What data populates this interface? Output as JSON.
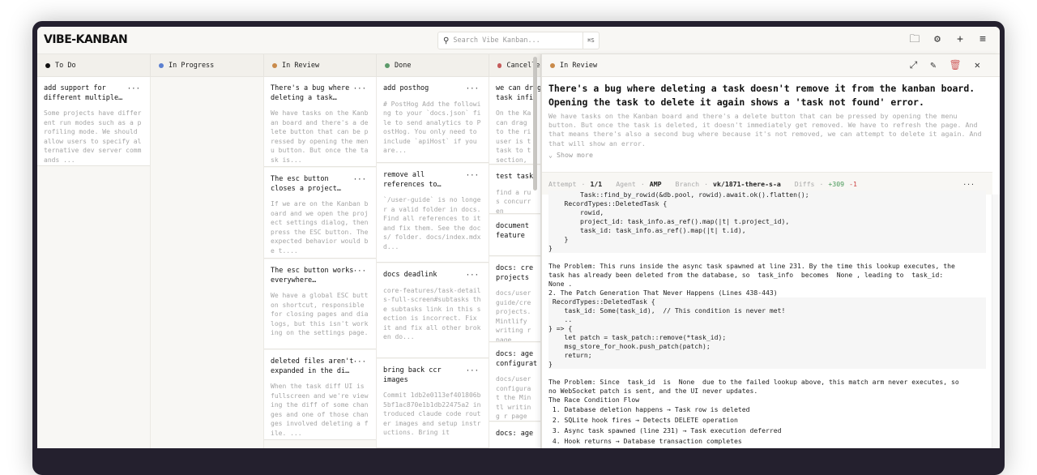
{
  "app": {
    "logo": "VIBE-KANBAN",
    "search_placeholder": "Search Vibe Kanban...",
    "search_shortcut": "⌘S"
  },
  "toolbar": {
    "icons": [
      "folder-icon",
      "gear-icon",
      "plus-icon",
      "menu-icon"
    ]
  },
  "columns": [
    {
      "label": "To Do",
      "color": "#111111",
      "cards": [
        {
          "title": "add support for different multiple…",
          "desc": "Some projects have different run modes such as a profiling mode. We should allow users to specify alternative dev server commands ..."
        }
      ]
    },
    {
      "label": "In Progress",
      "color": "#5b7fd0",
      "cards": []
    },
    {
      "label": "In Review",
      "color": "#c98a4a",
      "cards": [
        {
          "title": "There's a bug where deleting a task…",
          "desc": "We have tasks on the Kanban board and there's a delete button that can be pressed by opening the menu button. But once the task is..."
        },
        {
          "title": "The esc button closes a project…",
          "desc": "If we are on the Kanban board and we open the project settings dialog, then press the ESC button. The expected behavior would be t...."
        },
        {
          "title": "The esc button works everywhere…",
          "desc": "We have a global ESC button shortcut, responsible for closing pages and dialogs, but this isn't working on the settings page."
        },
        {
          "title": "deleted files aren't expanded in the di…",
          "desc": "When the task diff UI is fullscreen and we're viewing the diff of some changes and one of those changes involved deleting a file. ..."
        }
      ]
    },
    {
      "label": "Done",
      "color": "#5c9a6a",
      "cards": [
        {
          "title": "add posthog",
          "desc": "# PostHog Add the following to your `docs.json` file to send analytics to PostHog. You only need to include `apiHost` if you are..."
        },
        {
          "title": "remove all references to…",
          "desc": "`/user-guide` is no longer a valid folder in docs. Find all references to it and fix them. See the docs/ folder. docs/index.mdx d..."
        },
        {
          "title": "docs deadlink",
          "desc": "core-features/task-details-full-screen#subtasks the subtasks link in this section is incorrect. Fix it and fix all other broken do..."
        },
        {
          "title": "bring back ccr images",
          "desc": "Commit 1db2e0113ef401806b5bf1ac870e1b1db22475a2 introduced claude code router images and setup instructions. Bring it"
        }
      ]
    },
    {
      "label": "Cancelled",
      "color": "#c45a5a",
      "cards": [
        {
          "title": "we can drag task infin",
          "desc": "On the Ka can drag to the ri user is t task to t section,"
        },
        {
          "title": "test task",
          "desc": "find a rus concurren"
        },
        {
          "title": "document feature",
          "desc": ""
        },
        {
          "title": "docs: cre projects",
          "desc": "docs/user guide/cre projects. Mintlify writing r page"
        },
        {
          "title": "docs: age configurat",
          "desc": "docs/user configurat the Mintl writing r page"
        },
        {
          "title": "docs: age",
          "desc": ""
        }
      ]
    }
  ],
  "detail": {
    "status": "In Review",
    "status_color": "#c98a4a",
    "title": "There's a bug where deleting a task doesn't remove it from the kanban board. Opening the task to delete it again shows a 'task not found' error.",
    "description": "We have tasks on the Kanban board and there's a delete button that can be pressed by opening the menu button. But once the task is deleted, it doesn't immediately get removed. We have to refresh the page. And that means there's also a second bug where because it's not removed, we can attempt to delete it again. And that will show an error.",
    "show_more": "⌄ Show more",
    "attempt_label": "Attempt",
    "attempt": "1/1",
    "agent_label": "Agent",
    "agent": "AMP",
    "branch_label": "Branch",
    "branch": "vk/1871-there-s-a",
    "diffs_label": "Diffs",
    "added": "+309",
    "removed": "-1",
    "lines": [
      {
        "t": "        Task::find_by_rowid(&db.pool, rowid).await.ok().flatten();",
        "c": "code"
      },
      {
        "t": "    RecordTypes::DeletedTask {",
        "c": "code"
      },
      {
        "t": "        rowid,",
        "c": "code"
      },
      {
        "t": "        project_id: task_info.as_ref().map(|t| t.project_id),",
        "c": "code"
      },
      {
        "t": "        task_id: task_info.as_ref().map(|t| t.id),",
        "c": "code"
      },
      {
        "t": "    }",
        "c": "code"
      },
      {
        "t": "}",
        "c": "code"
      },
      {
        "t": "",
        "c": "gap"
      },
      {
        "t": "The Problem: This runs inside the async task spawned at line 231. By the time this lookup executes, the",
        "c": ""
      },
      {
        "t": "task has already been deleted from the database, so  task_info  becomes  None , leading to  task_id:",
        "c": ""
      },
      {
        "t": "None .",
        "c": ""
      },
      {
        "t": "2. The Patch Generation That Never Happens (Lines 438-443)",
        "c": ""
      },
      {
        "t": " RecordTypes::DeletedTask {",
        "c": "code"
      },
      {
        "t": "    task_id: Some(task_id),  // This condition is never met!",
        "c": "code"
      },
      {
        "t": "    ..",
        "c": "code"
      },
      {
        "t": "} => {",
        "c": "code"
      },
      {
        "t": "    let patch = task_patch::remove(*task_id);",
        "c": "code"
      },
      {
        "t": "    msg_store_for_hook.push_patch(patch);",
        "c": "code"
      },
      {
        "t": "    return;",
        "c": "code"
      },
      {
        "t": "}",
        "c": "code"
      },
      {
        "t": "",
        "c": "gap"
      },
      {
        "t": "The Problem: Since  task_id  is  None  due to the failed lookup above, this match arm never executes, so",
        "c": ""
      },
      {
        "t": "no WebSocket patch is sent, and the UI never updates.",
        "c": ""
      },
      {
        "t": "The Race Condition Flow",
        "c": ""
      },
      {
        "t": " 1. Database deletion happens → Task row is deleted",
        "c": "li"
      },
      {
        "t": " 2. SQLite hook fires → Detects DELETE operation",
        "c": "li"
      },
      {
        "t": " 3. Async task spawned (line 231) → Task execution deferred",
        "c": "li"
      },
      {
        "t": " 4. Hook returns → Database transaction completes",
        "c": "li"
      }
    ]
  }
}
